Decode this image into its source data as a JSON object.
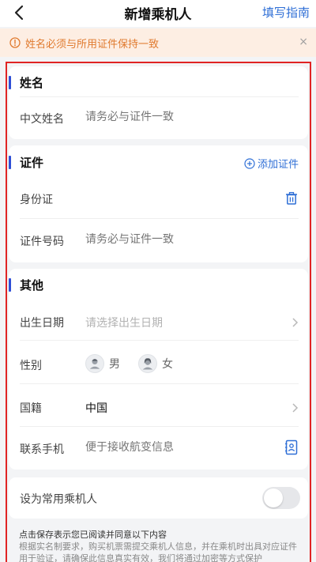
{
  "nav": {
    "title": "新增乘机人",
    "guide_label": "填写指南"
  },
  "notice": {
    "text": "姓名必须与所用证件保持一致",
    "close_label": "×"
  },
  "name_section": {
    "title": "姓名",
    "chinese_name_label": "中文姓名",
    "chinese_name_placeholder": "请务必与证件一致"
  },
  "id_section": {
    "title": "证件",
    "add_label": "添加证件",
    "id_type_label": "身份证",
    "id_number_label": "证件号码",
    "id_number_placeholder": "请务必与证件一致"
  },
  "other_section": {
    "title": "其他",
    "birthdate_label": "出生日期",
    "birthdate_placeholder": "请选择出生日期",
    "gender_label": "性别",
    "gender_male": "男",
    "gender_female": "女",
    "nationality_label": "国籍",
    "nationality_value": "中国",
    "phone_label": "联系手机",
    "phone_placeholder": "便于接收航变信息"
  },
  "frequent": {
    "label": "设为常用乘机人",
    "enabled": false
  },
  "agreement": {
    "title": "点击保存表示您已阅读并同意以下内容",
    "body": "根据实名制要求，购买机票需提交乘机人信息，并在乘机时出具对应证件用于验证，请确保此信息真实有效，我们将通过加密等方式保护"
  },
  "colors": {
    "accent": "#2f6fd6",
    "section_bar": "#2f4fd6",
    "notice_bg": "#fdeee3",
    "notice_text": "#e07a2e",
    "frame": "#e02424"
  },
  "icons": {
    "back": "chevron-left-icon",
    "notice": "alert-circle-icon",
    "close": "close-icon",
    "add": "plus-circle-icon",
    "delete": "trash-icon",
    "chevron": "chevron-right-icon",
    "contacts": "contact-book-icon",
    "avatar_male": "male-avatar-icon",
    "avatar_female": "female-avatar-icon"
  }
}
